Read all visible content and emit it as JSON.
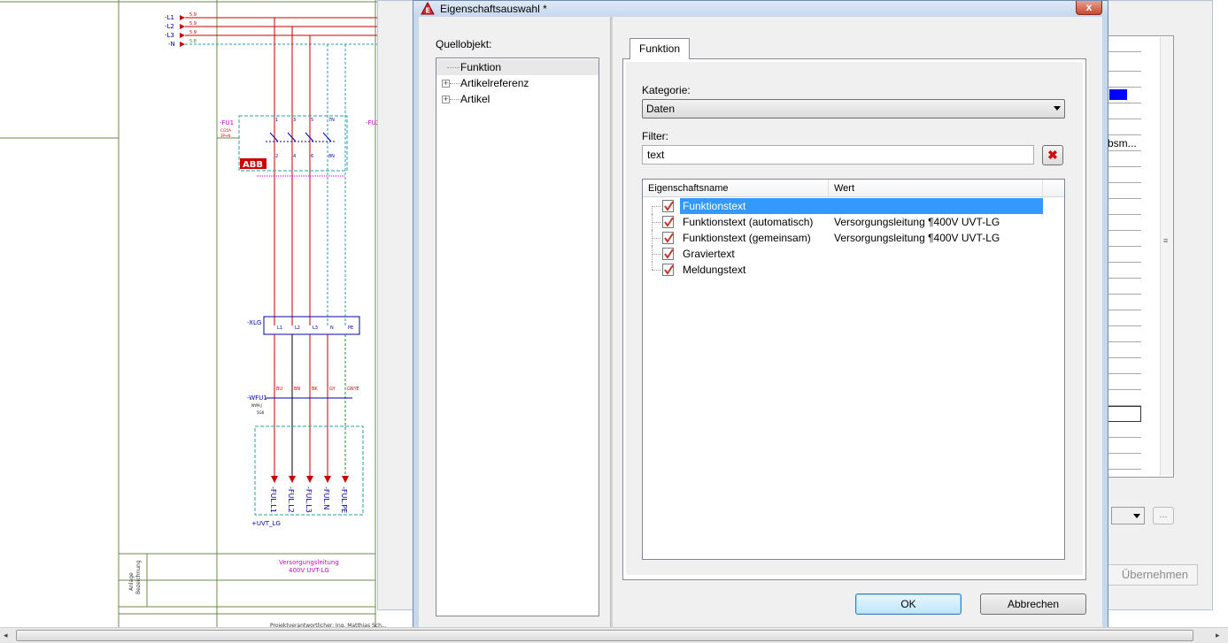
{
  "schematic": {
    "supply_lines": [
      "-L1",
      "-L2",
      "-L3",
      "-N"
    ],
    "supply_refs": [
      "5.9",
      "5.9",
      "5.9",
      "5.8"
    ],
    "fuse_tag": "-FU1",
    "fuse_tag2": "-FU2",
    "fuse_spec1": "C/25A",
    "fuse_spec2": "3P+N",
    "abb_logo": "ABB",
    "fuse_pins_top": [
      "1",
      "3",
      "5",
      "7N"
    ],
    "fuse_pins_bottom": [
      "2",
      "4",
      "6",
      "8N"
    ],
    "terminal_tag": "-XLG",
    "terminal_pins": [
      "L1",
      "L2",
      "L3",
      "N",
      "PE"
    ],
    "cable_tag": "-WFU1",
    "cable_spec1": "NYM-J",
    "cable_spec2": "5G6",
    "cable_colors": [
      "BU",
      "BN",
      "BK",
      "GY",
      "GNYE"
    ],
    "targets": [
      "-FUL.L1",
      "-FUL.L2",
      "-FUL.L3",
      "-FUL.N",
      "-FUL.PE"
    ],
    "location": "+UVT_LG",
    "title_line1": "Versorgungsleitung",
    "title_line2": "400V UVT-LG",
    "side_label1": "Anlage",
    "side_label2": "Bezeichnung",
    "bottom_text": "Projektverantwortlicher:   Ing. Matthias Sch..."
  },
  "background_window": {
    "cell_text": "bsm...",
    "apply_button": "Übernehmen",
    "ellipsis_button": "..."
  },
  "dialog": {
    "title": "Eigenschaftsauswahl *",
    "close_label": "x",
    "source_label": "Quellobjekt:",
    "tree": [
      {
        "label": "Funktion",
        "expandable": false,
        "selected": true
      },
      {
        "label": "Artikelreferenz",
        "expandable": true,
        "selected": false
      },
      {
        "label": "Artikel",
        "expandable": true,
        "selected": false
      }
    ],
    "tab_label": "Funktion",
    "category_label": "Kategorie:",
    "category_value": "Daten",
    "filter_label": "Filter:",
    "filter_value": "text",
    "columns": [
      "Eigenschaftsname",
      "Wert"
    ],
    "properties": [
      {
        "name": "Funktionstext",
        "value": "",
        "selected": true
      },
      {
        "name": "Funktionstext (automatisch)",
        "value": "Versorgungsleitung ¶400V UVT-LG",
        "selected": false
      },
      {
        "name": "Funktionstext (gemeinsam)",
        "value": "Versorgungsleitung ¶400V UVT-LG",
        "selected": false
      },
      {
        "name": "Graviertext",
        "value": "",
        "selected": false
      },
      {
        "name": "Meldungstext",
        "value": "",
        "selected": false
      }
    ],
    "ok_label": "OK",
    "cancel_label": "Abbrechen"
  },
  "colors": {
    "selection": "#3399ff",
    "wire_red": "#cc0000",
    "wire_blue": "#0000aa",
    "frame_green": "#2a8a2a"
  }
}
